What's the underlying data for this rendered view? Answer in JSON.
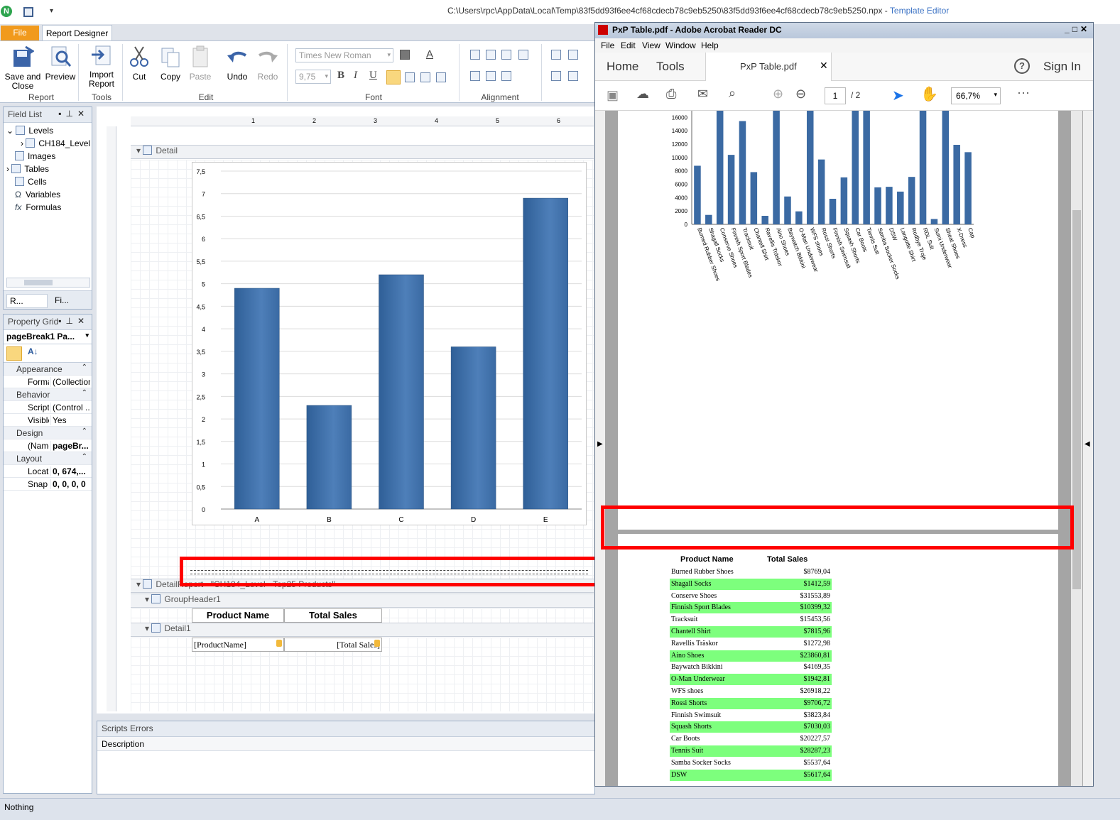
{
  "titlebar": {
    "path": "C:\\Users\\rpc\\AppData\\Local\\Temp\\83f5dd93f6ee4cf68cdecb78c9eb5250\\83f5dd93f6ee4cf68cdecb78c9eb5250.npx",
    "separator": " - ",
    "app": "Template Editor"
  },
  "tabs": {
    "file": "File",
    "designer": "Report Designer"
  },
  "ribbon": {
    "save_close": "Save and Close",
    "preview": "Preview",
    "import_report": "Import Report",
    "cut": "Cut",
    "copy": "Copy",
    "paste": "Paste",
    "undo": "Undo",
    "redo": "Redo",
    "font_name": "Times New Roman",
    "font_size": "9,75",
    "groups": {
      "report": "Report",
      "tools": "Tools",
      "edit": "Edit",
      "font": "Font",
      "alignment": "Alignment"
    }
  },
  "field_list": {
    "title": "Field List",
    "items": [
      "Levels",
      "CH184_Level",
      "Images",
      "Tables",
      "Cells",
      "Variables",
      "Formulas"
    ],
    "tabs": [
      "R...",
      "Fi..."
    ]
  },
  "property_grid": {
    "title": "Property Grid",
    "selected": "pageBreak1  Pa...",
    "rows": [
      {
        "type": "cat",
        "label": "Appearance"
      },
      {
        "type": "prop",
        "name": "Forma",
        "value": "(Collection)"
      },
      {
        "type": "cat",
        "label": "Behavior"
      },
      {
        "type": "prop",
        "name": "Script",
        "value": "(Control ..."
      },
      {
        "type": "prop",
        "name": "Visible",
        "value": "Yes"
      },
      {
        "type": "cat",
        "label": "Design"
      },
      {
        "type": "prop",
        "name": "(Name",
        "value": "pageBr..."
      },
      {
        "type": "cat",
        "label": "Layout"
      },
      {
        "type": "prop",
        "name": "Locat",
        "value": "0, 674,..."
      },
      {
        "type": "prop",
        "name": "Snap",
        "value": "0, 0, 0, 0"
      }
    ]
  },
  "designer": {
    "detail_band": "Detail",
    "detail_report_band": "DetailReport - \"CH184_Level - Top25 Products\"",
    "group_header_band": "GroupHeader1",
    "detail1_band": "Detail1",
    "header_product": "Product Name",
    "header_sales": "Total Sales",
    "field_product": "[ProductName]",
    "field_sales": "[Total Sales]",
    "ruler": [
      "1",
      "2",
      "3",
      "4",
      "5",
      "6"
    ]
  },
  "chart_data": [
    {
      "type": "bar",
      "categories": [
        "A",
        "B",
        "C",
        "D",
        "E"
      ],
      "values": [
        4.9,
        2.3,
        5.2,
        3.6,
        6.9
      ],
      "ylim": [
        0,
        7.5
      ],
      "yticks": [
        "0",
        "0,5",
        "1",
        "1,5",
        "2",
        "2,5",
        "3",
        "3,5",
        "4",
        "4,5",
        "5",
        "5,5",
        "6",
        "6,5",
        "7",
        "7,5"
      ],
      "grid": true
    },
    {
      "type": "bar",
      "categories": [
        "Burned Rubber Shoes",
        "Shagall Socks",
        "Conserve Shoes",
        "Finnish Sport Blades",
        "Tracksuit",
        "Chantell Shirt",
        "Ravellis Träskor",
        "Aino Shoes",
        "Baywatch Bikkini",
        "O-Man Underwear",
        "WFS shoes",
        "Rossi Shorts",
        "Finnish Swimsuit",
        "Squash Shorts",
        "Car Boots",
        "Tennis Suit",
        "Samba Socker  Socks",
        "DSW",
        "Langotte Shirt",
        "Rodbye Troje",
        "RDL Suit",
        "Sumi Underwear",
        "Sheat Shoes",
        "X-Dress",
        "Cap"
      ],
      "values": [
        8769.04,
        1412.59,
        31553.89,
        10399.32,
        15453.56,
        7815.96,
        1272.98,
        23860.81,
        4169.35,
        1942.81,
        26918.22,
        9706.72,
        3823.84,
        7030.03,
        20227.57,
        28287.23,
        5537.64,
        5617.64,
        4900,
        7100,
        19000,
        800,
        18500,
        11900,
        10800
      ],
      "ylim": [
        0,
        17000
      ],
      "yticks": [
        "0",
        "2000",
        "4000",
        "6000",
        "8000",
        "10000",
        "12000",
        "14000",
        "16000"
      ]
    }
  ],
  "bottom": {
    "scripts_errors": "Scripts Errors",
    "description": "Description",
    "status": "Nothing"
  },
  "acrobat": {
    "title": "PxP Table.pdf - Adobe Acrobat Reader DC",
    "menu": [
      "File",
      "Edit",
      "View",
      "Window",
      "Help"
    ],
    "home": "Home",
    "tools": "Tools",
    "doc_tab": "PxP Table.pdf",
    "sign_in": "Sign In",
    "page_current": "1",
    "page_total": "/  2",
    "zoom": "66,7%",
    "table_headers": [
      "Product Name",
      "Total Sales"
    ],
    "rows": [
      [
        "Burned Rubber Shoes",
        "$8769,04"
      ],
      [
        "Shagall Socks",
        "$1412,59"
      ],
      [
        "Conserve Shoes",
        "$31553,89"
      ],
      [
        "Finnish Sport Blades",
        "$10399,32"
      ],
      [
        "Tracksuit",
        "$15453,56"
      ],
      [
        "Chantell Shirt",
        "$7815,96"
      ],
      [
        "Ravellis Träskor",
        "$1272,98"
      ],
      [
        "Aino Shoes",
        "$23860,81"
      ],
      [
        "Baywatch Bikkini",
        "$4169,35"
      ],
      [
        "O-Man Underwear",
        "$1942,81"
      ],
      [
        "WFS shoes",
        "$26918,22"
      ],
      [
        "Rossi Shorts",
        "$9706,72"
      ],
      [
        "Finnish Swimsuit",
        "$3823,84"
      ],
      [
        "Squash Shorts",
        "$7030,03"
      ],
      [
        "Car Boots",
        "$20227,57"
      ],
      [
        "Tennis Suit",
        "$28287,23"
      ],
      [
        "Samba Socker  Socks",
        "$5537,64"
      ],
      [
        "DSW",
        "$5617,64"
      ]
    ]
  },
  "colors": {
    "highlight_row": "#7dff7d",
    "bar": "#3b6aa3",
    "red_box": "#ff0000",
    "file_tab": "#f19a1d"
  }
}
